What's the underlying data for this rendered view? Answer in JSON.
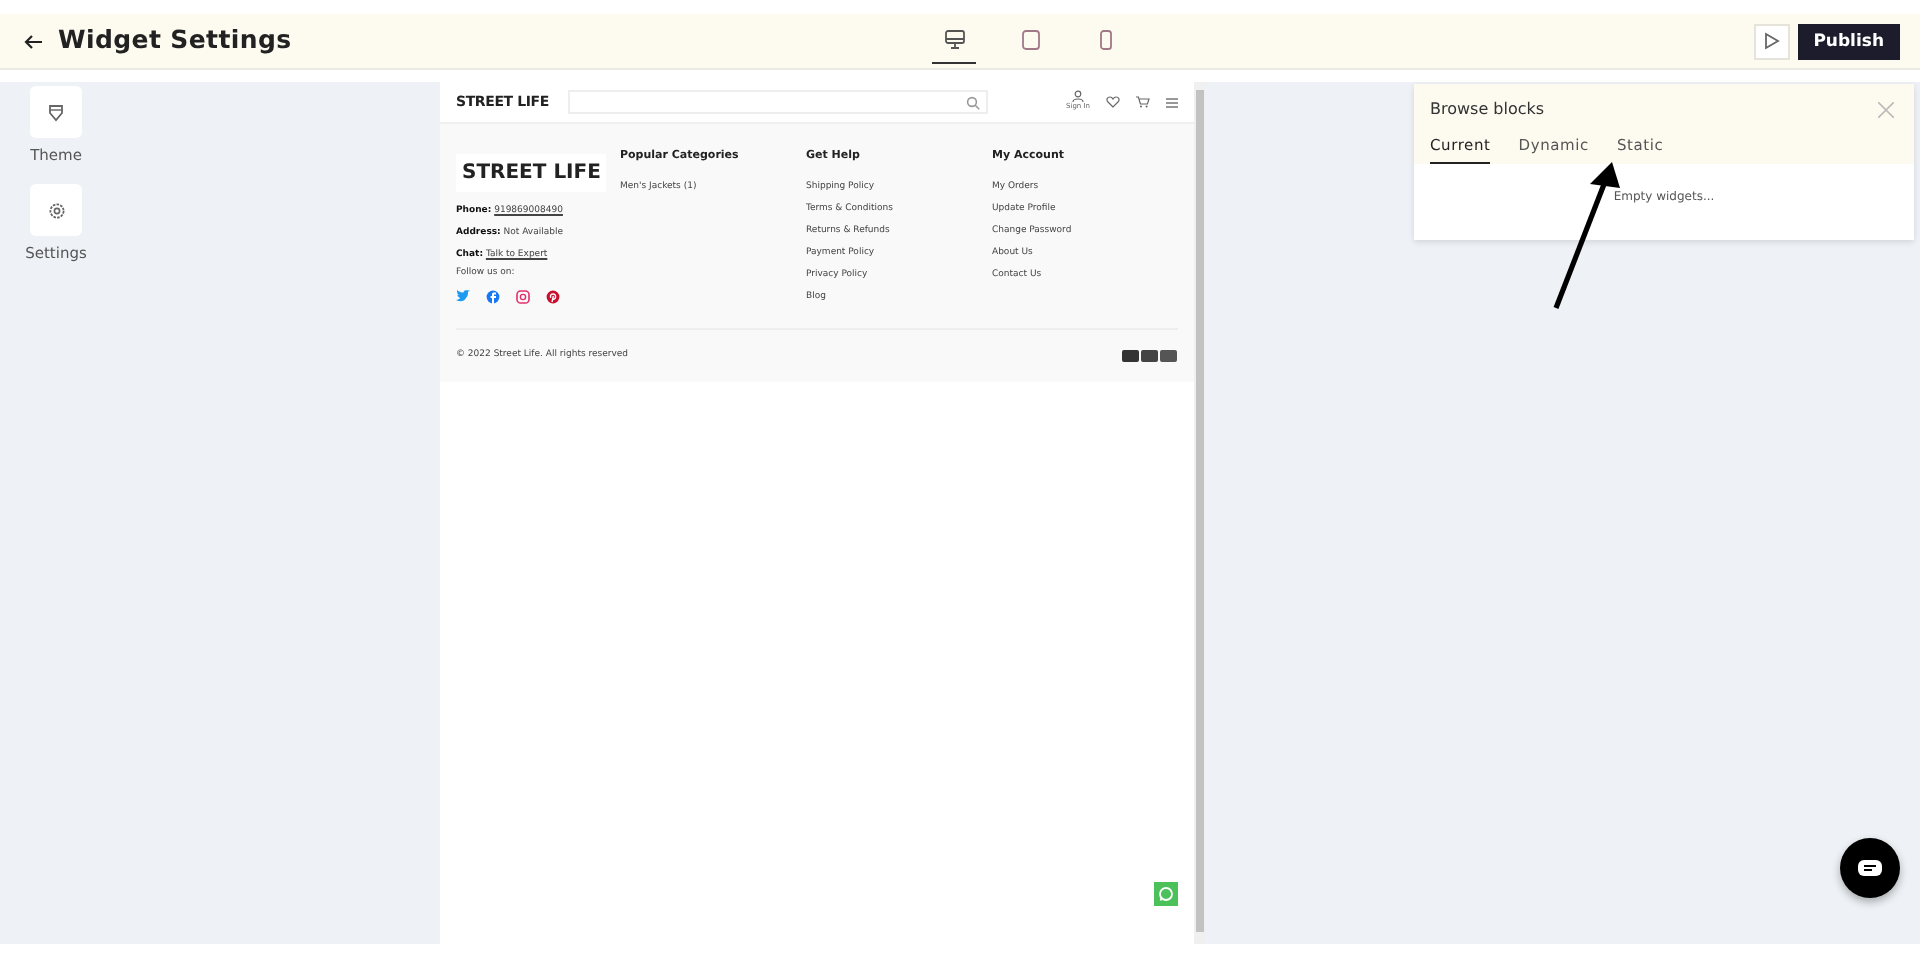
{
  "header": {
    "title": "Widget Settings",
    "devices": [
      {
        "kind": "desktop",
        "selected": true
      },
      {
        "kind": "tablet",
        "selected": false
      },
      {
        "kind": "mobile",
        "selected": false
      }
    ],
    "publish": "Publish"
  },
  "sidebar": {
    "items": [
      {
        "kind": "theme",
        "label": "Theme"
      },
      {
        "kind": "settings",
        "label": "Settings"
      }
    ]
  },
  "preview": {
    "logo": "STREET LIFE",
    "sign_in": "Sign In",
    "footer": {
      "logo": "STREET LIFE",
      "contact": [
        {
          "label": "Phone:",
          "value": "919869008490",
          "link": true
        },
        {
          "label": "Address:",
          "value": "Not Available",
          "link": false
        },
        {
          "label": "Chat:",
          "value": "Talk to Expert",
          "link": true
        }
      ],
      "follow": "Follow us on:",
      "social": [
        {
          "kind": "twitter",
          "color": "#1d9bf0"
        },
        {
          "kind": "facebook",
          "color": "#1877f2"
        },
        {
          "kind": "instagram",
          "color": "#e1306c"
        },
        {
          "kind": "pinterest",
          "color": "#c8102e"
        }
      ],
      "columns": [
        {
          "title": "Popular Categories",
          "links": [
            "Men's Jackets (1)"
          ]
        },
        {
          "title": "Get Help",
          "links": [
            "Shipping Policy",
            "Terms & Conditions",
            "Returns & Refunds",
            "Payment Policy",
            "Privacy Policy",
            "Blog"
          ]
        },
        {
          "title": "My Account",
          "links": [
            "My Orders",
            "Update Profile",
            "Change Password",
            "About Us",
            "Contact Us"
          ]
        }
      ],
      "copyright": "© 2022 Street Life. All rights reserved"
    }
  },
  "panel": {
    "title": "Browse blocks",
    "tabs": [
      {
        "label": "Current",
        "selected": true
      },
      {
        "label": "Dynamic",
        "selected": false
      },
      {
        "label": "Static",
        "selected": false
      }
    ],
    "empty": "Empty widgets..."
  }
}
